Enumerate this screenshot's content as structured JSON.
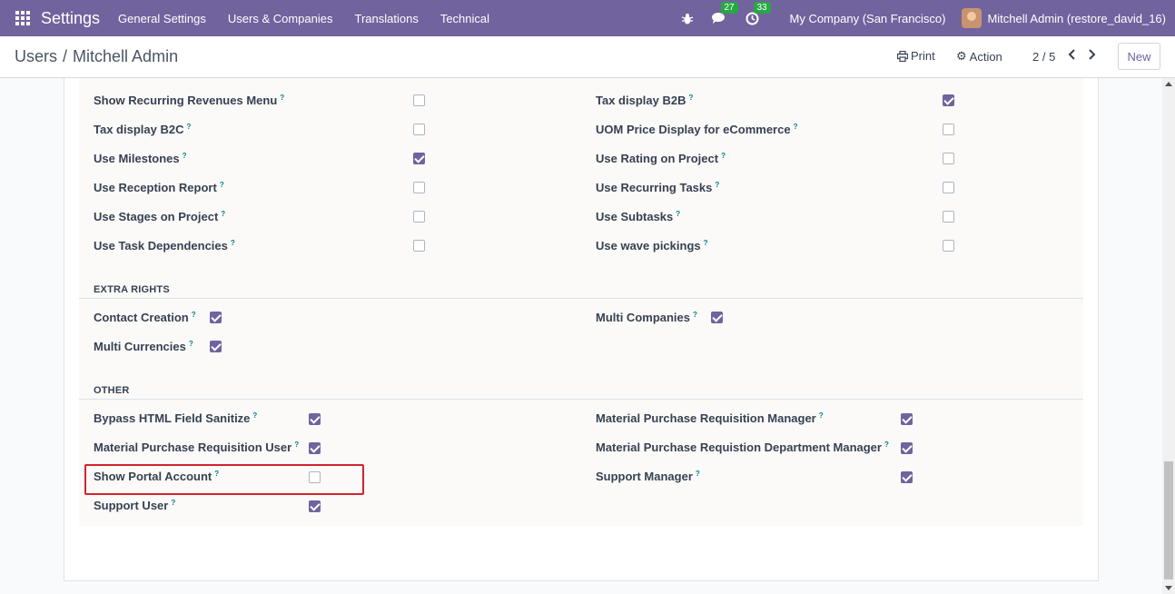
{
  "navbar": {
    "apps_icon": "apps-grid-icon",
    "brand": "Settings",
    "menu": [
      "General Settings",
      "Users & Companies",
      "Translations",
      "Technical"
    ],
    "messages_badge": "27",
    "activities_badge": "33",
    "company": "My Company (San Francisco)",
    "user": "Mitchell Admin (restore_david_16)",
    "color": "#71639e"
  },
  "control": {
    "breadcrumb_parent": "Users",
    "breadcrumb_sep": "/",
    "breadcrumb_current": "Mitchell Admin",
    "print_label": "Print",
    "action_label": "Action",
    "pager": "2 / 5",
    "new_label": "New"
  },
  "settings_rows": [
    {
      "label": "Show Recurring Revenues Menu",
      "checked": false
    },
    {
      "label": "Tax display B2B",
      "checked": true
    },
    {
      "label": "Tax display B2C",
      "checked": false
    },
    {
      "label": "UOM Price Display for eCommerce",
      "checked": false
    },
    {
      "label": "Use Milestones",
      "checked": true
    },
    {
      "label": "Use Rating on Project",
      "checked": false
    },
    {
      "label": "Use Reception Report",
      "checked": false
    },
    {
      "label": "Use Recurring Tasks",
      "checked": false
    },
    {
      "label": "Use Stages on Project",
      "checked": false
    },
    {
      "label": "Use Subtasks",
      "checked": false
    },
    {
      "label": "Use Task Dependencies",
      "checked": false
    },
    {
      "label": "Use wave pickings",
      "checked": false
    }
  ],
  "extra_rights": {
    "title": "EXTRA RIGHTS",
    "rows": [
      {
        "label": "Contact Creation",
        "checked": true
      },
      {
        "label": "Multi Companies",
        "checked": true
      },
      {
        "label": "Multi Currencies",
        "checked": true
      }
    ]
  },
  "other": {
    "title": "OTHER",
    "rows": [
      {
        "label": "Bypass HTML Field Sanitize",
        "checked": true
      },
      {
        "label": "Material Purchase Requisition Manager",
        "checked": true
      },
      {
        "label": "Material Purchase Requisition User",
        "checked": true
      },
      {
        "label": "Material Purchase Requistion Department Manager",
        "checked": true
      },
      {
        "label": "Show Portal Account",
        "checked": false
      },
      {
        "label": "Support Manager",
        "checked": true
      },
      {
        "label": "Support User",
        "checked": true
      }
    ]
  },
  "help_mark": "?"
}
